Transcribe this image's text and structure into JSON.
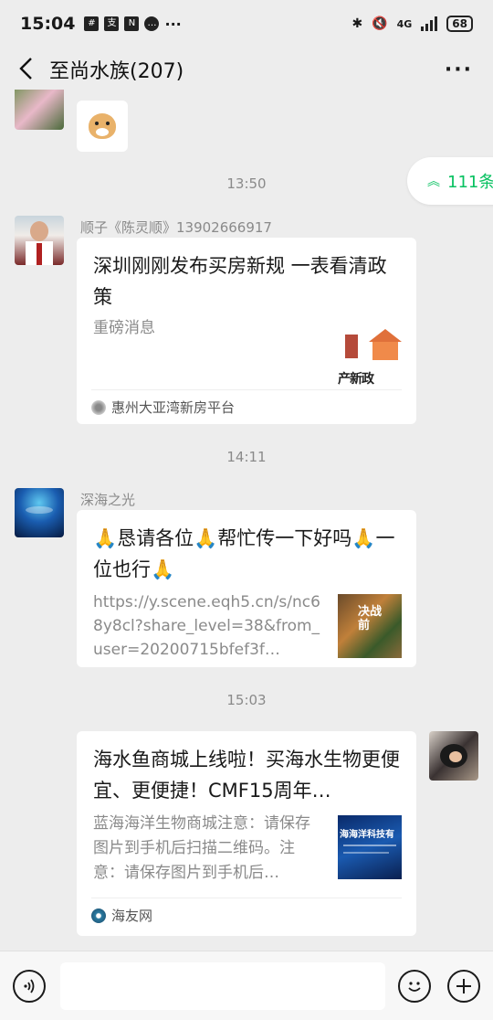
{
  "status_bar": {
    "time": "15:04",
    "battery": "68",
    "network": "4G"
  },
  "header": {
    "title": "至尚水族(207)"
  },
  "jump_pill": {
    "label": "111条"
  },
  "messages": [
    {
      "timestamp": "13:50",
      "sender": "顺子《陈灵顺》13902666917",
      "card_title": "深圳刚刚发布买房新规 一表看清政策",
      "card_desc": "重磅消息",
      "thumb_text": "产新政",
      "source": "惠州大亚湾新房平台"
    },
    {
      "timestamp": "14:11",
      "sender": "深海之光",
      "card_title": "🙏恳请各位🙏帮忙传一下好吗🙏一位也行🙏",
      "card_desc": "https://y.scene.eqh5.cn/s/nc68y8cl?share_level=38&from_user=20200715bfef3f…",
      "thumb_text": "决战前",
      "source": ""
    },
    {
      "timestamp": "15:03",
      "sender": "",
      "card_title": "海水鱼商城上线啦！买海水生物更便宜、更便捷！CMF15周年…",
      "card_desc": "蓝海海洋生物商城注意：请保存图片到手机后扫描二维码。注意：请保存图片到手机后…",
      "thumb_text": "海海洋科技有",
      "source": "海友网"
    }
  ],
  "icons": {
    "back": "chevron-left-icon",
    "more": "more-icon",
    "voice": "voice-icon",
    "emoji": "emoji-icon",
    "plus": "plus-icon"
  },
  "colors": {
    "accent": "#07c160",
    "background": "#ededed"
  }
}
